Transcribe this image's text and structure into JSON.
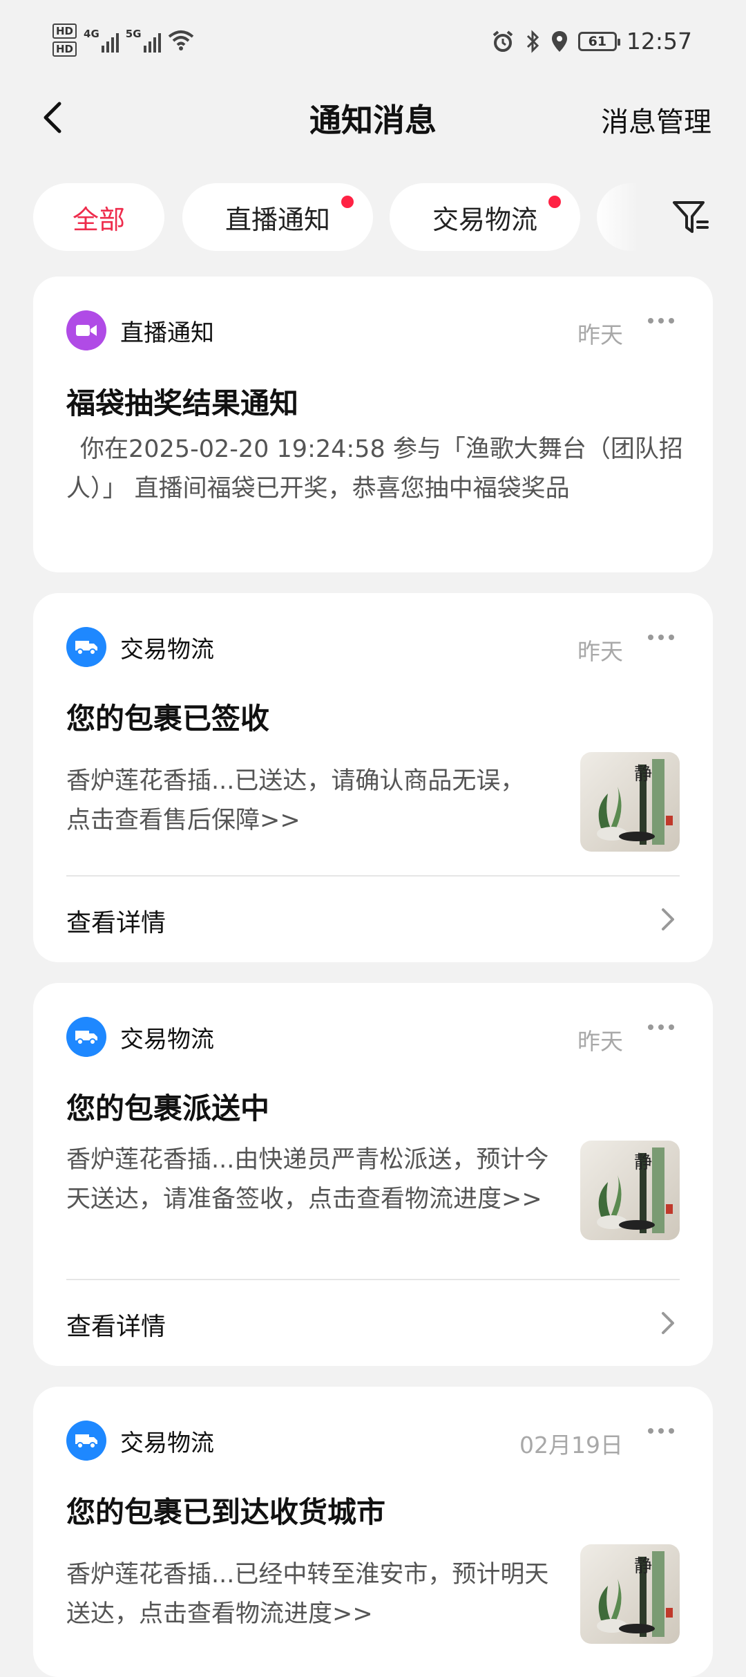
{
  "status_bar": {
    "hd1": "HD",
    "hd2": "HD",
    "net1": "4G",
    "net2": "5G",
    "battery": "61",
    "time": "12:57"
  },
  "header": {
    "title": "通知消息",
    "manage": "消息管理"
  },
  "tabs": [
    {
      "label": "全部",
      "active": true,
      "dot": false
    },
    {
      "label": "直播通知",
      "active": false,
      "dot": true
    },
    {
      "label": "交易物流",
      "active": false,
      "dot": true
    }
  ],
  "cards": [
    {
      "category": "直播通知",
      "category_icon": "video-camera-icon",
      "time": "昨天",
      "title": "福袋抽奖结果通知",
      "body": "你在2025-02-20 19:24:58 参与「渔歌大舞台（团队招人）」 直播间福袋已开奖，恭喜您抽中福袋奖品"
    },
    {
      "category": "交易物流",
      "category_icon": "delivery-truck-icon",
      "time": "昨天",
      "title": "您的包裹已签收",
      "body": "香炉莲花香插...已送达，请确认商品无误，点击查看售后保障>>",
      "detail": "查看详情"
    },
    {
      "category": "交易物流",
      "category_icon": "delivery-truck-icon",
      "time": "昨天",
      "title": "您的包裹派送中",
      "body": "香炉莲花香插...由快递员严青松派送，预计今天送达，请准备签收，点击查看物流进度>>",
      "detail": "查看详情"
    },
    {
      "category": "交易物流",
      "category_icon": "delivery-truck-icon",
      "time": "02月19日",
      "title": "您的包裹已到达收货城市",
      "body": "香炉莲花香插...已经中转至淮安市，预计明天送达，点击查看物流进度>>"
    }
  ],
  "product_thumb_text": "静",
  "colors": {
    "accent": "#ee2c4c",
    "dot": "#ff2244",
    "live_icon": "#b04be6",
    "logistics_icon": "#1e88ff",
    "background": "#f2f2f2"
  }
}
